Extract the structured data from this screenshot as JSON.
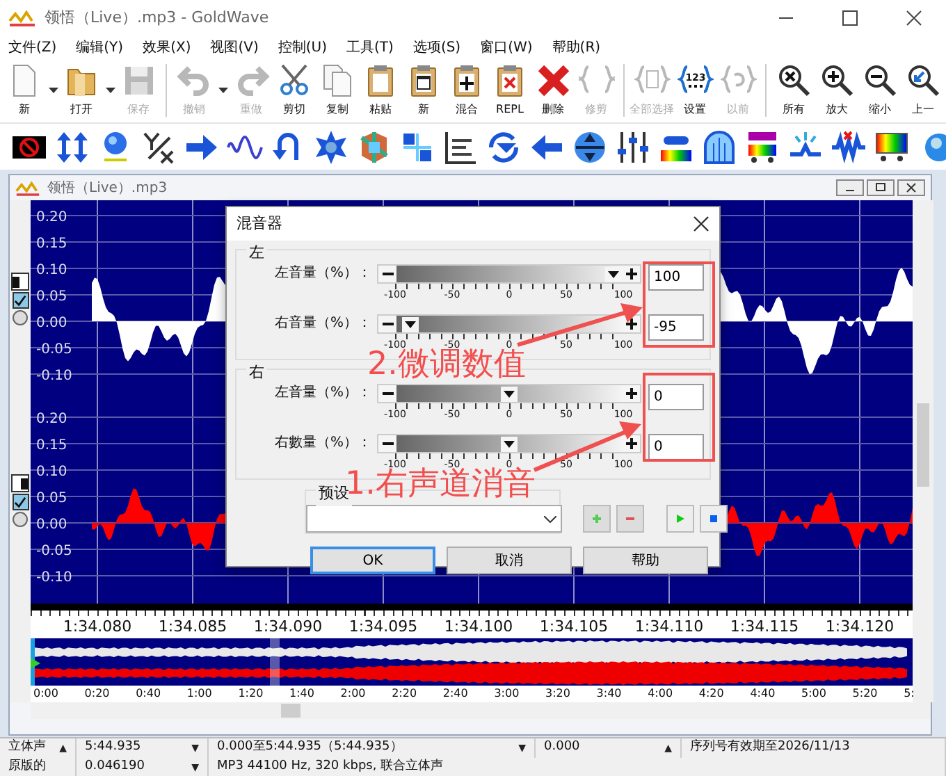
{
  "window": {
    "title": "领悟（Live）.mp3 - GoldWave"
  },
  "menu": [
    "文件(Z)",
    "编辑(Y)",
    "效果(X)",
    "视图(V)",
    "控制(U)",
    "工具(T)",
    "选项(S)",
    "窗口(W)",
    "帮助(R)"
  ],
  "toolbar": [
    {
      "label": "新",
      "disabled": false,
      "dropdown": true
    },
    {
      "label": "打开",
      "disabled": false,
      "dropdown": true
    },
    {
      "label": "保存",
      "disabled": true,
      "dropdown": false,
      "separator": true
    },
    {
      "label": "撤销",
      "disabled": true,
      "dropdown": true
    },
    {
      "label": "重做",
      "disabled": true,
      "dropdown": false
    },
    {
      "label": "剪切",
      "disabled": false,
      "dropdown": false
    },
    {
      "label": "复制",
      "disabled": false,
      "dropdown": false
    },
    {
      "label": "粘贴",
      "disabled": false,
      "dropdown": false
    },
    {
      "label": "新",
      "disabled": false,
      "dropdown": false
    },
    {
      "label": "混合",
      "disabled": false,
      "dropdown": false
    },
    {
      "label": "REPL",
      "disabled": false,
      "dropdown": false
    },
    {
      "label": "删除",
      "disabled": false,
      "dropdown": false
    },
    {
      "label": "修剪",
      "disabled": true,
      "dropdown": false,
      "separator": true
    },
    {
      "label": "全部选择",
      "disabled": true,
      "dropdown": false
    },
    {
      "label": "设置",
      "disabled": false,
      "dropdown": false,
      "icon_text": "123"
    },
    {
      "label": "以前",
      "disabled": true,
      "dropdown": false,
      "separator": true
    },
    {
      "label": "所有",
      "disabled": false,
      "dropdown": false
    },
    {
      "label": "放大",
      "disabled": false,
      "dropdown": false
    },
    {
      "label": "缩小",
      "disabled": false,
      "dropdown": false
    },
    {
      "label": "上一",
      "disabled": false,
      "dropdown": false
    }
  ],
  "document": {
    "title": "领悟（Live）.mp3",
    "channels": [
      {
        "color": "#ffffff",
        "checked": true,
        "selected": false,
        "y_labels": [
          "0.20",
          "0.15",
          "0.10",
          "0.05",
          "0.00",
          "-0.05",
          "-0.10"
        ]
      },
      {
        "color": "#ff0000",
        "checked": true,
        "selected": false,
        "y_labels": [
          "0.20",
          "0.15",
          "0.10",
          "0.05",
          "0.00",
          "-0.05",
          "-0.10"
        ]
      }
    ],
    "time_labels": [
      "1:34.080",
      "1:34.085",
      "1:34.090",
      "1:34.095",
      "1:34.100",
      "1:34.105",
      "1:34.110",
      "1:34.115",
      "1:34.120"
    ],
    "overview_labels": [
      "0:00",
      "0:20",
      "0:40",
      "1:00",
      "1:20",
      "1:40",
      "2:00",
      "2:20",
      "2:40",
      "3:00",
      "3:20",
      "3:40",
      "4:00",
      "4:20",
      "4:40",
      "5:00",
      "5:20",
      "5:"
    ]
  },
  "dialog": {
    "title": "混音器",
    "groups": [
      {
        "label": "左",
        "rows": [
          {
            "label": "左音量（%）：",
            "level": 1,
            "value": "100",
            "ticks": [
              "-100",
              "-50",
              "0",
              "50",
              "100"
            ]
          },
          {
            "label": "右音量（%）：",
            "level": 0.025,
            "value": "-95",
            "ticks": [
              "-100",
              "-50",
              "0",
              "50",
              "100"
            ]
          }
        ]
      },
      {
        "label": "右",
        "rows": [
          {
            "label": "左音量（%）：",
            "level": 0.5,
            "value": "0",
            "ticks": [
              "-100",
              "-50",
              "0",
              "50",
              "100"
            ]
          },
          {
            "label": "右數量（%）：",
            "level": 0.5,
            "value": "0",
            "ticks": [
              "-100",
              "-50",
              "0",
              "50",
              "100"
            ]
          }
        ]
      }
    ],
    "preset": {
      "label": "预设"
    },
    "buttons": [
      {
        "label": "OK",
        "selected": true
      },
      {
        "label": "取消",
        "selected": false
      },
      {
        "label": "帮助",
        "selected": false
      }
    ]
  },
  "annotations": [
    {
      "text": "2.微调数值"
    },
    {
      "text": "1.右声道消音"
    }
  ],
  "status_bar": [
    [
      {
        "text": "立体声",
        "arrow": "▲"
      },
      {
        "text": "5:44.935",
        "arrow": "▼"
      },
      {
        "text": "0.000至5:44.935（5:44.935）",
        "arrow": "▼"
      },
      {
        "text": "0.000",
        "arrow": "▲"
      },
      {
        "text": "序列号有效期至2026/11/13"
      }
    ],
    [
      {
        "text": "原版的"
      },
      {
        "text": "0.046190",
        "arrow": "▼"
      },
      {
        "text": "MP3 44100 Hz, 320 kbps, 联合立体声"
      }
    ]
  ]
}
